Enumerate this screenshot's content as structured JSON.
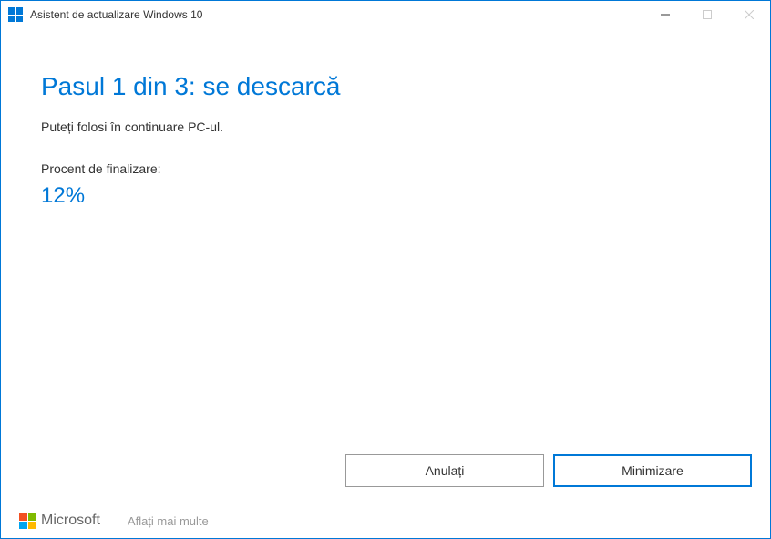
{
  "titlebar": {
    "title": "Asistent de actualizare Windows 10"
  },
  "main": {
    "heading": "Pasul 1 din 3: se descarcă",
    "subtext": "Puteți folosi în continuare PC-ul.",
    "progress_label": "Procent de finalizare:",
    "progress_percent": "12%"
  },
  "buttons": {
    "cancel": "Anulați",
    "minimize": "Minimizare"
  },
  "footer": {
    "brand": "Microsoft",
    "learn_more": "Aflați mai multe"
  }
}
